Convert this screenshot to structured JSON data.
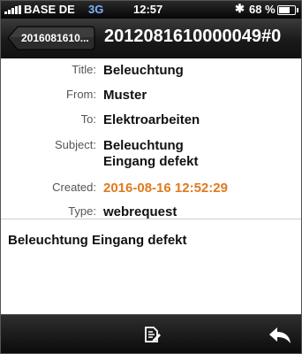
{
  "status_bar": {
    "carrier": "BASE DE",
    "network": "3G",
    "time": "12:57",
    "battery": "68 %",
    "battery_level": 0.68,
    "icons": [
      "signal-icon",
      "bluetooth-icon",
      "battery-icon"
    ]
  },
  "nav": {
    "back_label": "2016081610...",
    "title": "2012081610000049#0"
  },
  "ticket": {
    "title_label": "Title:",
    "title": "Beleuchtung",
    "from_label": "From:",
    "from": "Muster",
    "to_label": "To:",
    "to": "Elektroarbeiten",
    "subject_label": "Subject:",
    "subject_line1": "Beleuchtung",
    "subject_line2": "Eingang defekt",
    "created_label": "Created:",
    "created": "2016-08-16 12:52:29",
    "type_label": "Type:",
    "type": "webrequest"
  },
  "body": {
    "text": "Beleuchtung Eingang defekt"
  },
  "toolbar": {
    "icons": [
      "compose-note-icon",
      "reply-icon"
    ]
  },
  "colors": {
    "accent_date": "#e07a1f",
    "bar_dark": "#111111"
  }
}
